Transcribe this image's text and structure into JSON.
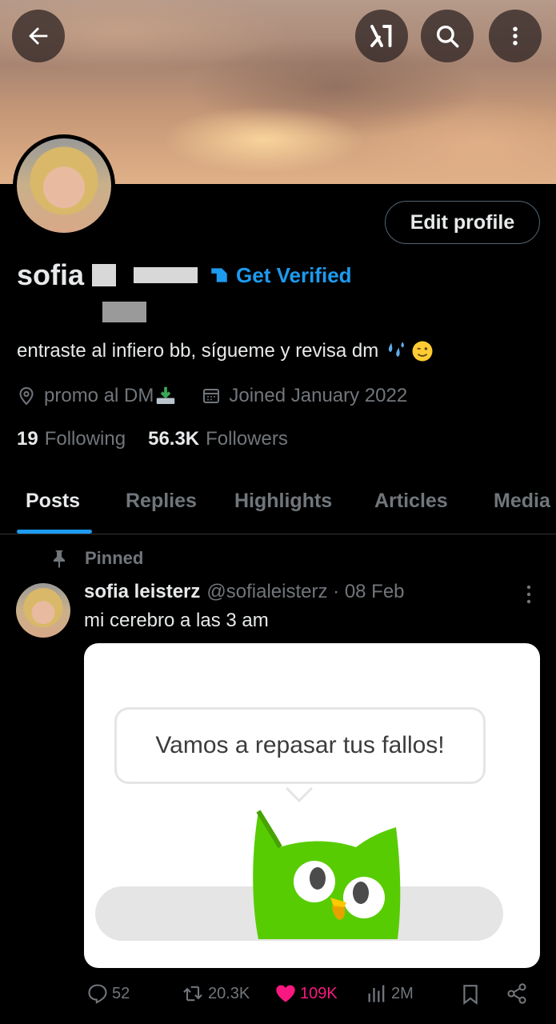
{
  "header": {
    "back_icon": "arrow-left-icon",
    "grok_icon": "grok-icon",
    "search_icon": "search-icon",
    "more_icon": "more-vertical-icon"
  },
  "profile": {
    "edit_button_label": "Edit profile",
    "name": "sofia",
    "get_verified_label": "Get Verified",
    "bio": "entraste al infiero bb, sígueme y revisa dm",
    "bio_emoji": [
      "sweat-droplets",
      "winking-face"
    ],
    "location": "promo al DM",
    "location_emoji": "inbox-tray",
    "joined": "Joined January 2022",
    "following_count": "19",
    "following_label": "Following",
    "followers_count": "56.3K",
    "followers_label": "Followers"
  },
  "tabs": [
    "Posts",
    "Replies",
    "Highlights",
    "Articles",
    "Media"
  ],
  "active_tab": "Posts",
  "pinned_post": {
    "pinned_label": "Pinned",
    "author": "sofia leisterz",
    "handle_date": "@sofialeisterz · 08 Feb",
    "text": "mi cerebro a las 3 am",
    "media": {
      "speech_text": "Vamos a repasar tus fallos!"
    },
    "actions": {
      "replies": "52",
      "reposts": "20.3K",
      "likes": "109K",
      "views": "2M"
    }
  },
  "colors": {
    "accent": "#1d9bf0",
    "like": "#f91880",
    "muted": "#71767b",
    "text": "#e7e9ea",
    "owl_green": "#58cc02"
  }
}
